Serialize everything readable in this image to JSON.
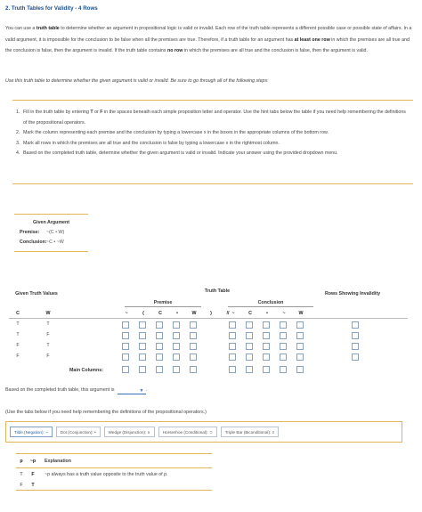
{
  "header": {
    "title": "2. Truth Tables for Validity - 4 Rows"
  },
  "intro": {
    "p1": "You can use a ",
    "p1b": "truth table",
    "p2": " to determine whether an argument in propositional logic is valid or invalid. Each row of the truth table represents a different possible case or possible state of affairs. In a valid argument, it is impossible for the conclusion to be false when all the premises are true. Therefore, if a truth table for an argument has ",
    "p2b": "at least one row",
    "p3": " in which the premises are all true and the conclusion is false, then the argument is invalid. If the truth table contains ",
    "p3b": "no row",
    "p4": " in which the premises are all true and the conclusion is false, then the argument is valid."
  },
  "use_instruction": "Use this truth table to determine whether the given argument is valid or invalid. Be sure to go through all of the following steps:",
  "steps": [
    {
      "num": "1.",
      "a": "Fill in the truth table by entering ",
      "t": "T",
      "b": " or ",
      "f": "F",
      "c": " in the spaces beneath each simple proposition letter and operator. Use the hint tabs below the table if you need help remembering the definitions of the propositional operators."
    },
    {
      "num": "2.",
      "text": "Mark the column representing each premise and the conclusion by typing a lowercase x in the boxes in the appropriate columns of the bottom row."
    },
    {
      "num": "3.",
      "text": "Mark all rows in which the premises are all true and the conclusion is false by typing a lowercase x in the rightmost column."
    },
    {
      "num": "4.",
      "text": "Based on the completed truth table, determine whether the given argument is valid or invalid. Indicate your answer using the provided dropdown menu."
    }
  ],
  "given_argument": {
    "title": "Given Argument",
    "premise_label": "Premise:",
    "premise_value": "~(C • W)",
    "conclusion_label": "Conclusion:",
    "conclusion_value": "~C • ~W"
  },
  "truth_table": {
    "title": "Truth Table",
    "given_truth_values": "Given Truth Values",
    "premise_label": "Premise",
    "conclusion_label": "Conclusion",
    "rows_showing": "Rows Showing Invalidity",
    "var_c": "C",
    "var_w": "W",
    "premise_symbols": [
      "~",
      "(",
      "C",
      "•",
      "W",
      ")",
      "//"
    ],
    "conclusion_symbols": [
      "~",
      "C",
      "•",
      "~",
      "W"
    ],
    "rows": [
      {
        "c": "T",
        "w": "T"
      },
      {
        "c": "T",
        "w": "F"
      },
      {
        "c": "F",
        "w": "T"
      },
      {
        "c": "F",
        "w": "F"
      }
    ],
    "main_columns_label": "Main Columns:"
  },
  "based_on": {
    "text": "Based on the completed truth table, this argument is",
    "after": "."
  },
  "use_tabs": "(Use the tabs below if you need help remembering the definitions of the propositional operators.)",
  "tabs": [
    "Tilde (Negation): ~",
    "Dot (Conjunction): •",
    "Wedge (Disjunction): ∨",
    "Horseshoe (Conditional): ⊃",
    "Triple Bar (Biconditional): ≡"
  ],
  "tilde_panel": {
    "h_p": "p",
    "h_np": "~p",
    "h_expl": "Explanation",
    "rows": [
      {
        "p": "T",
        "np": "F",
        "expl": "~p always has a truth value opposite to the truth value of p."
      },
      {
        "p": "F",
        "np": "T",
        "expl": ""
      }
    ]
  },
  "colors": {
    "accent_rule": "#e3b55a",
    "title_blue": "#1a4f8b",
    "checkbox_border": "#8aa3c0"
  }
}
